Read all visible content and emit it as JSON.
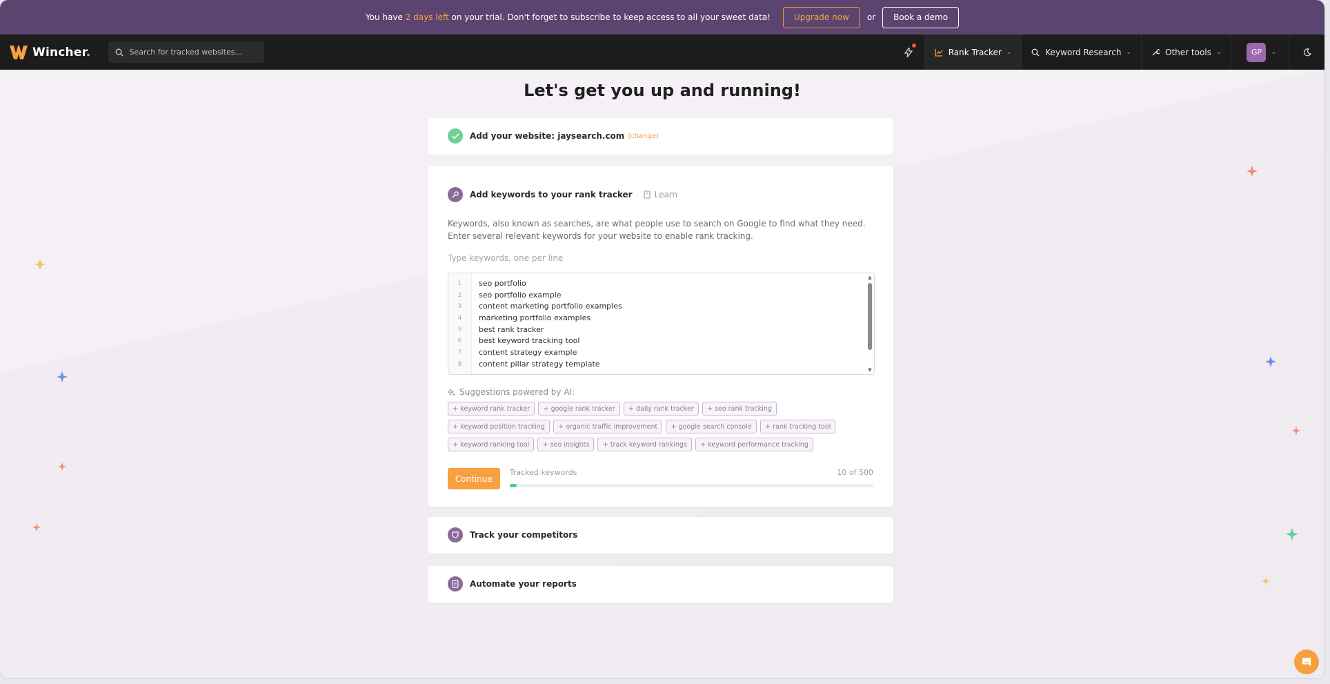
{
  "banner": {
    "text_before": "You have ",
    "highlight": "2 days left",
    "text_after": " on your trial. Don't forget to subscribe to keep access to all your sweet data!",
    "upgrade_label": "Upgrade now",
    "or": "or",
    "demo_label": "Book a demo"
  },
  "nav": {
    "logo_text": "Wincher",
    "search_placeholder": "Search for tracked websites...",
    "items": [
      {
        "label": "Rank Tracker",
        "icon": "chart-line-icon",
        "active": true
      },
      {
        "label": "Keyword Research",
        "icon": "search-icon"
      },
      {
        "label": "Other tools",
        "icon": "wrench-icon"
      }
    ],
    "avatar_initials": "GP"
  },
  "page": {
    "title": "Let's get you up and running!"
  },
  "step1": {
    "title": "Add your website: jaysearch.com",
    "change_label": "(change)"
  },
  "step2": {
    "title": "Add keywords to your rank tracker",
    "learn_label": "Learn",
    "description": "Keywords, also known as searches, are what people use to search on Google to find what they need. Enter several relevant keywords for your website to enable rank tracking.",
    "field_label": "Type keywords, one per line",
    "keywords": [
      "seo portfolio",
      "seo portfolio example",
      "content marketing portfolio examples",
      "marketing portfolio examples",
      "best rank tracker",
      "best keyword tracking tool",
      "content strategy example",
      "content pillar strategy template"
    ],
    "ai_label": "Suggestions powered by AI:",
    "suggestions": [
      "keyword rank tracker",
      "google rank tracker",
      "daily rank tracker",
      "seo rank tracking",
      "keyword position tracking",
      "organic traffic improvement",
      "google search console",
      "rank tracking tool",
      "keyword ranking tool",
      "seo insights",
      "track keyword rankings",
      "keyword performance tracking"
    ],
    "continue_label": "Continue",
    "tracked_label": "Tracked keywords",
    "tracked_count": "10 of 500",
    "tracked_fraction": 0.02
  },
  "step3": {
    "title": "Track your competitors"
  },
  "step4": {
    "title": "Automate your reports"
  },
  "colors": {
    "banner": "#5c4470",
    "accent": "#f7a040",
    "nav": "#1c1c1c",
    "success": "#6fcf97",
    "step_icon": "#8a6a9a"
  }
}
